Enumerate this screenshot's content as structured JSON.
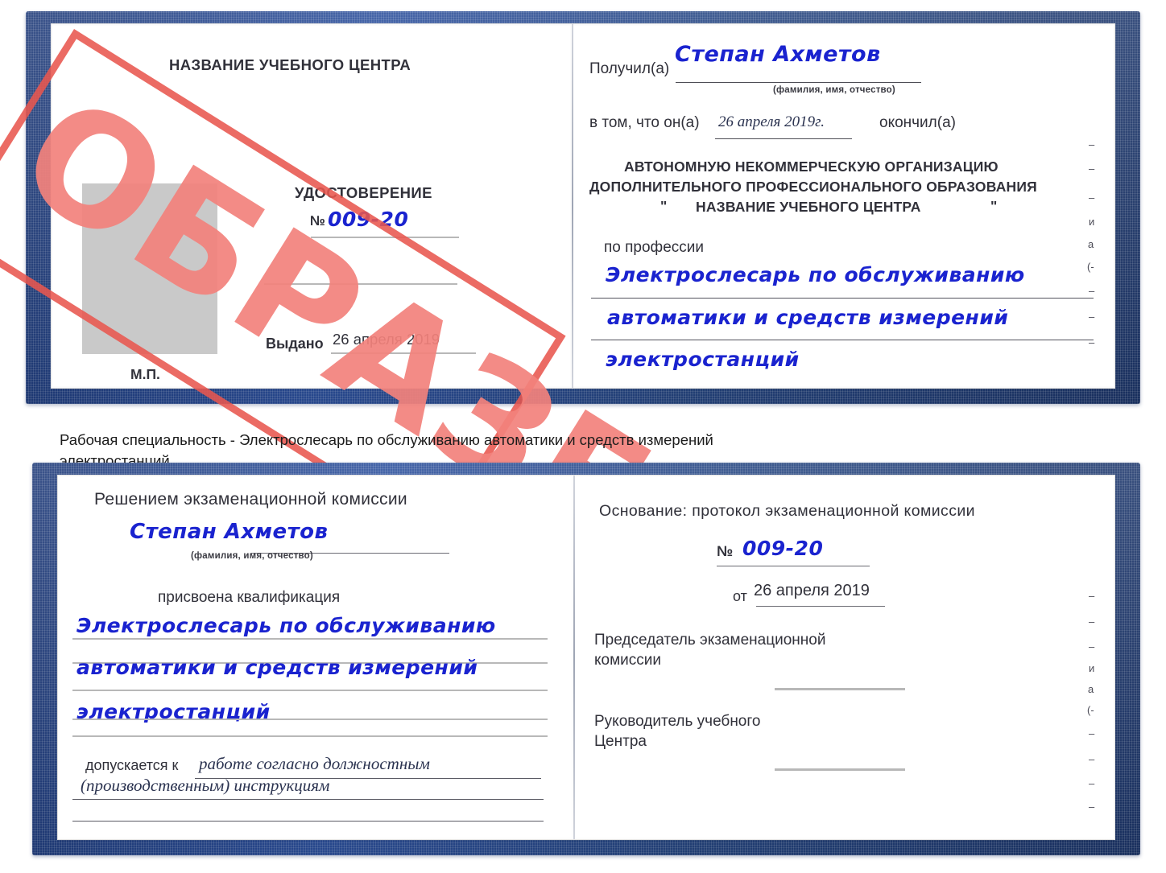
{
  "caption": {
    "line1": "Рабочая специальность - Электрослесарь по обслуживанию автоматики и средств измерений",
    "line2": "электростанций"
  },
  "watermark": {
    "text": "ОБРАЗЕЦ",
    "color": "#ef7f79",
    "frame_color": "#e8564e"
  },
  "certificate_front": {
    "left_page": {
      "center_name": "НАЗВАНИЕ УЧЕБНОГО ЦЕНТРА",
      "doc_type": "УДОСТОВЕРЕНИЕ",
      "number_label": "№",
      "number_value": "009-20",
      "issued_label": "Выдано",
      "issued_value": "26 апреля 2019",
      "seal_label": "М.П.",
      "photo_placeholder": "photo-area"
    },
    "right_page": {
      "received_label": "Получил(а)",
      "received_value": "Степан Ахметов",
      "fio_hint": "(фамилия, имя, отчество)",
      "in_that_label": "в том, что он(а)",
      "date_value": "26 апреля 2019г.",
      "finished_label": "окончил(а)",
      "org_line1": "АВТОНОМНУЮ НЕКОММЕРЧЕСКУЮ ОРГАНИЗАЦИЮ",
      "org_line2": "ДОПОЛНИТЕЛЬНОГО ПРОФЕССИОНАЛЬНОГО ОБРАЗОВАНИЯ",
      "org_quote_open": "\"",
      "org_line3": "НАЗВАНИЕ УЧЕБНОГО ЦЕНТРА",
      "org_quote_close": "\"",
      "profession_label": "по профессии",
      "profession_line1": "Электрослесарь по обслуживанию",
      "profession_line2": "автоматики и средств измерений",
      "profession_line3": "электростанций",
      "margin_marks": [
        "–",
        "–",
        "–",
        "и",
        "а",
        "(-",
        "–",
        "–",
        "–"
      ]
    }
  },
  "certificate_back": {
    "left_page": {
      "heading": "Решением экзаменационной комиссии",
      "name_value": "Степан Ахметов",
      "fio_hint": "(фамилия, имя, отчество)",
      "qualification_label": "присвоена квалификация",
      "qualification_line1": "Электрослесарь по обслуживанию",
      "qualification_line2": "автоматики и средств измерений",
      "qualification_line3": "электростанций",
      "admitted_label": "допускается к",
      "admitted_value1": "работе согласно должностным",
      "admitted_value2": "(производственным) инструкциям"
    },
    "right_page": {
      "basis_label": "Основание: протокол экзаменационной комиссии",
      "number_label": "№",
      "number_value": "009-20",
      "from_label": "от",
      "from_value": "26 апреля 2019",
      "chairman_line1": "Председатель экзаменационной",
      "chairman_line2": "комиссии",
      "head_line1": "Руководитель учебного",
      "head_line2": "Центра",
      "margin_marks": [
        "–",
        "–",
        "–",
        "и",
        "а",
        "(-",
        "–",
        "–",
        "–",
        "–"
      ]
    }
  }
}
